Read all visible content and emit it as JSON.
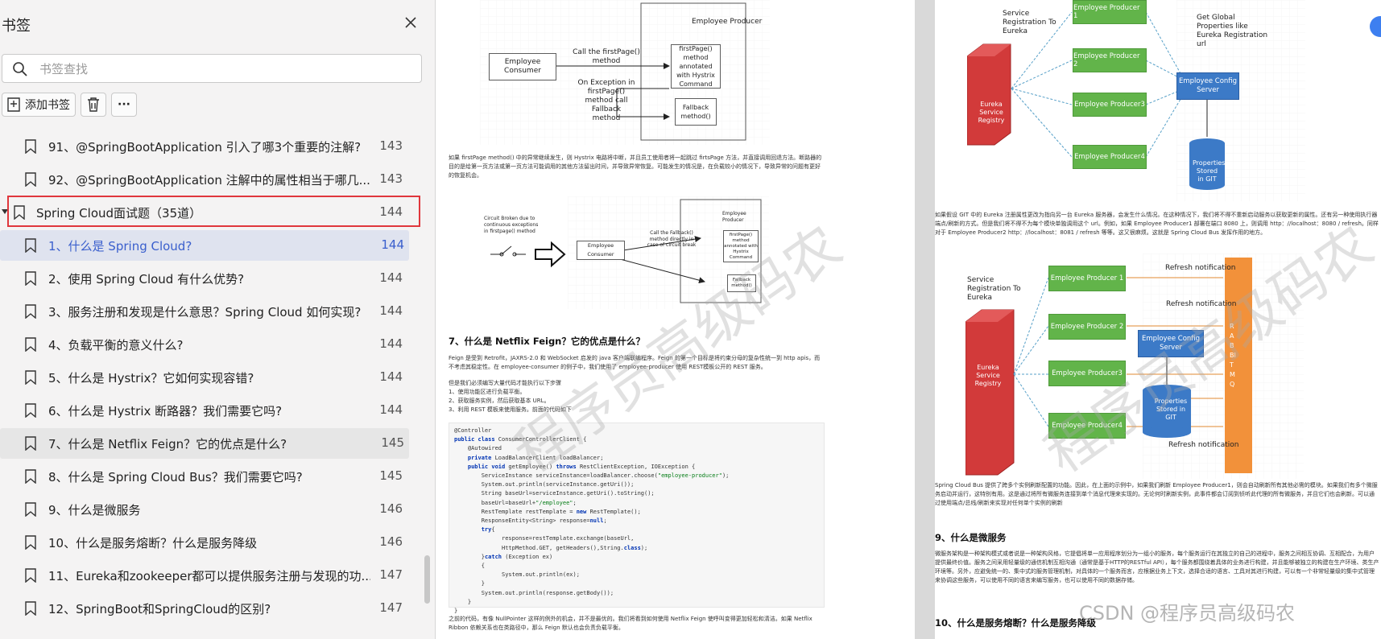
{
  "sidebar": {
    "title": "书签",
    "search_placeholder": "书签查找",
    "add_bookmark_label": "添加书签",
    "more_label": "···",
    "items": [
      {
        "label": "91、@SpringBootApplication 引入了哪3个重要的注解?",
        "page": "143"
      },
      {
        "label": "92、@SpringBootApplication 注解中的属性相当于哪几...",
        "page": "143"
      },
      {
        "label": "Spring Cloud面试题（35道）",
        "page": "144"
      },
      {
        "label": "1、什么是 Spring Cloud?",
        "page": "144"
      },
      {
        "label": "2、使用 Spring Cloud 有什么优势?",
        "page": "144"
      },
      {
        "label": "3、服务注册和发现是什么意思？Spring Cloud 如何实现?",
        "page": "144"
      },
      {
        "label": "4、负载平衡的意义什么?",
        "page": "144"
      },
      {
        "label": "5、什么是 Hystrix？它如何实现容错?",
        "page": "144"
      },
      {
        "label": "6、什么是 Hystrix 断路器？我们需要它吗?",
        "page": "144"
      },
      {
        "label": "7、什么是 Netflix Feign？它的优点是什么?",
        "page": "145"
      },
      {
        "label": "8、什么是 Spring Cloud Bus？我们需要它吗?",
        "page": "145"
      },
      {
        "label": "9、什么是微服务",
        "page": "146"
      },
      {
        "label": "10、什么是服务熔断？什么是服务降级",
        "page": "146"
      },
      {
        "label": "11、Eureka和zookeeper都可以提供服务注册与发现的功...",
        "page": "147"
      },
      {
        "label": "12、SpringBoot和SpringCloud的区别?",
        "page": "147"
      }
    ]
  },
  "page1": {
    "diagram1": {
      "consumer": "Employee Consumer",
      "producer": "Employee Producer",
      "call_label": "Call the firstPage() method",
      "hystrix_box": "firstPage() method annotated with Hystrix Command",
      "exception_label": "On Exception in firstPage() method call Fallback method",
      "fallback_box": "Fallback method()"
    },
    "para1": "如果 firstPage method() 中的异常继续发生，则 Hystrix 电路将中断，并且员工使用者将一起跳过 firtsPage 方法，并直接调用回退方法。断路器的目的是给第一页方法或第一页方法可能调用的其他方法留出时间，并导致异常恢复。可能发生的情况是，在负载较小的情况下，导致异常的问题有更好的恢复机会。",
    "diagram2": {
      "broken": "Circuit Broken due to continuous exceptions in firstpage() method",
      "consumer": "Employee Consumer",
      "call_fallback": "Call the Fallback() method directly in case of circuit break",
      "producer": "Employee Producer",
      "hystrix": "firstPage() method annotated with Hystrix Command",
      "fallback": "Fallback method()"
    },
    "heading7": "7、什么是 Netflix Feign？它的优点是什么？",
    "para2": "Feign 是受到 Retrofit，JAXRS-2.0 和 WebSocket 启发的 java 客户端联编程序。Feign 的第一个目标是将约束分母的复杂性统一到 http apis，而不考虑其稳定性。在 employee-consumer 的例子中，我们使用了 employee-producer 使用 REST模板公开的 REST 服务。",
    "para3": "但是我们必须编写大量代码才能执行以下步骤",
    "steps": [
      "1、使用功能区进行负载平衡。",
      "2、获取服务实例，然后获取基本 URL。",
      "3、利用 REST 模板来使用服务。前面的代码如下"
    ],
    "para4": "之前的代码，有像 NullPointer 这样的例外的机会，并不是最优的。我们将看到如何使用 Netflix Feign 使呼叫变得更加轻松和清洁。如果 Netflix Ribbon 依赖关系也在类路径中，那么 Feign 默认也会负责负载平衡。"
  },
  "page2": {
    "registration": "Service Registration To Eureka",
    "producers": [
      "Employee Producer 1",
      "Employee Producer 2",
      "Employee Producer3",
      "Employee Producer4"
    ],
    "global_props": "Get Global Properties like Eureka Registration url",
    "eureka": "Eureka Service Registry",
    "config_server": "Employee Config Server",
    "properties": "Properties Stored in GIT",
    "para1": "如果假设 GIT 中的 Eureka 注册属性更改为指向另一台 Eureka 服务器，会发生什么情况。在这种情况下，我们将不得不重新启动服务以获取更新的属性。还有另一种使用执行器端点/刷新的方式。但是我们将不得不为每个模块单独调用这个 url。例如，如果 Employee Producer1 部署在端口 8080 上，则调用 http：//localhost：8080 / refresh。同样对于 Employee Producer2 http：//localhost：8081 / refresh 等等。这又很麻烦。这就是 Spring Cloud Bus 发挥作用的地方。",
    "refresh": "Refresh notification",
    "rabbitmq": "RABBITMQ",
    "para2": "Spring Cloud Bus 提供了跨多个实例刷新配置的功能。因此，在上面的示例中，如果我们刷新 Employee Producer1，则会自动刷新所有其他必需的模块。如果我们有多个微服务启动并运行，这特别有用。这是通过将所有微服务连接到单个消息代理来实现的。无论何时刷新实例，此事件都会订阅到侦听此代理的所有微服务，并且它们也会刷新。可以通过使用端点/总线/刷新来实现对任何单个实例的刷新",
    "heading9": "9、什么是微服务",
    "para3": "微服务架构是一种架构模式或者说是一种架构风格，它提倡将单一应用程序划分为一组小的服务，每个服务运行在其独立的自己的进程中，服务之间相互协调、互相配合，为用户提供最终价值。服务之间采用轻量级的通信机制互相沟通（通常是基于HTTP的RESTful API），每个服务都围绕着具体的业务进行构建，并且能够被独立的构建在生产环境、类生产环境等。另外，应避免统一的、集中式的服务管理机制，对具体的一个服务而言，应根据业务上下文，选择合适的语言、工具对其进行构建，可以有一个非常轻量级的集中式管理来协调这些服务，可以使用不同的语言来编写服务，也可以使用不同的数据存储。",
    "heading10": "10、什么是服务熔断？什么是服务降级"
  },
  "watermark": "程序员高级码农",
  "csdn_mark": "CSDN @程序员高级码农"
}
